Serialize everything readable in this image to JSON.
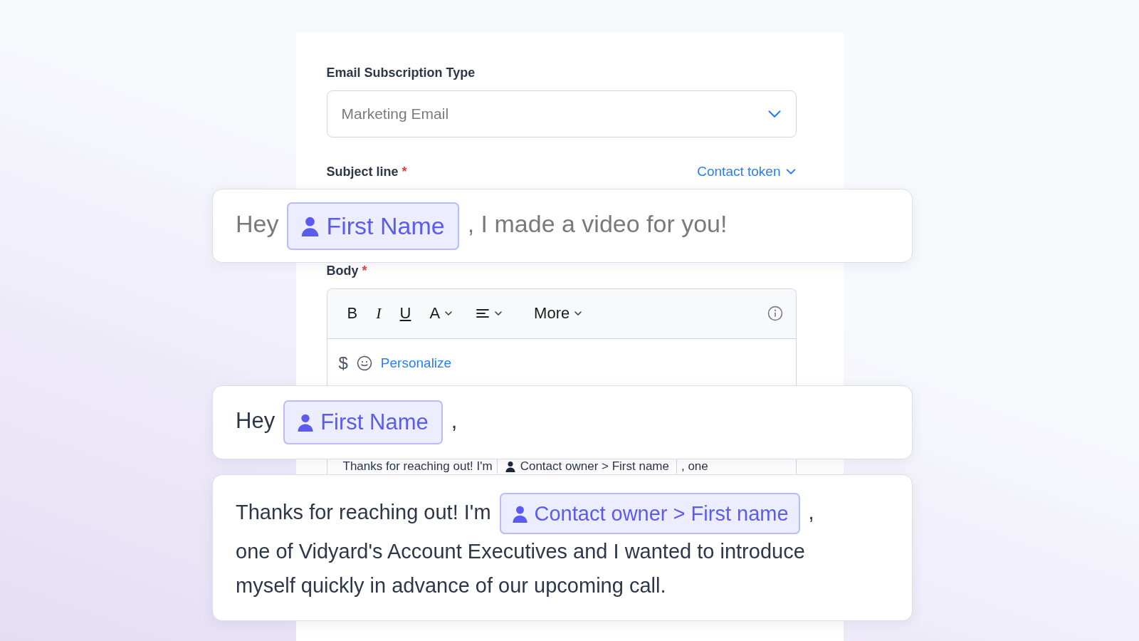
{
  "form": {
    "subscription": {
      "label": "Email Subscription Type",
      "value": "Marketing Email"
    },
    "subject": {
      "label": "Subject line",
      "required_mark": "*",
      "token_link": "Contact token"
    },
    "body": {
      "label": "Body",
      "required_mark": "*",
      "toolbar": [
        {
          "kind": "bold",
          "label": "B"
        },
        {
          "kind": "italic",
          "label": "I"
        },
        {
          "kind": "underline",
          "label": "U"
        },
        {
          "kind": "font",
          "label": "A"
        },
        {
          "kind": "align"
        },
        {
          "kind": "more",
          "label": "More"
        },
        {
          "kind": "info"
        }
      ],
      "insert_row": {
        "dollar": "$",
        "personalize": "Personalize"
      },
      "preview_line": [
        {
          "kind": "text",
          "text": "Thanks for reaching out! I'm"
        },
        {
          "kind": "token",
          "text": "Contact owner > First name"
        },
        {
          "kind": "text",
          "text": ", one"
        }
      ]
    }
  },
  "overlays": [
    {
      "muted": true,
      "segments": [
        {
          "kind": "text",
          "text": "Hey"
        },
        {
          "kind": "token",
          "text": "First Name"
        },
        {
          "kind": "text",
          "text": ", I made a video for you!"
        }
      ]
    },
    {
      "muted": false,
      "segments": [
        {
          "kind": "text",
          "text": "Hey"
        },
        {
          "kind": "token",
          "text": "First Name"
        },
        {
          "kind": "text",
          "text": ","
        }
      ]
    },
    {
      "muted": false,
      "segments": [
        {
          "kind": "text",
          "text": "Thanks for reaching out! I'm"
        },
        {
          "kind": "token",
          "text": "Contact owner > First name"
        },
        {
          "kind": "text",
          "text": ","
        },
        {
          "kind": "block_text",
          "text": "one of Vidyard's Account Executives and I wanted to introduce myself quickly in advance of our upcoming call."
        }
      ]
    }
  ]
}
